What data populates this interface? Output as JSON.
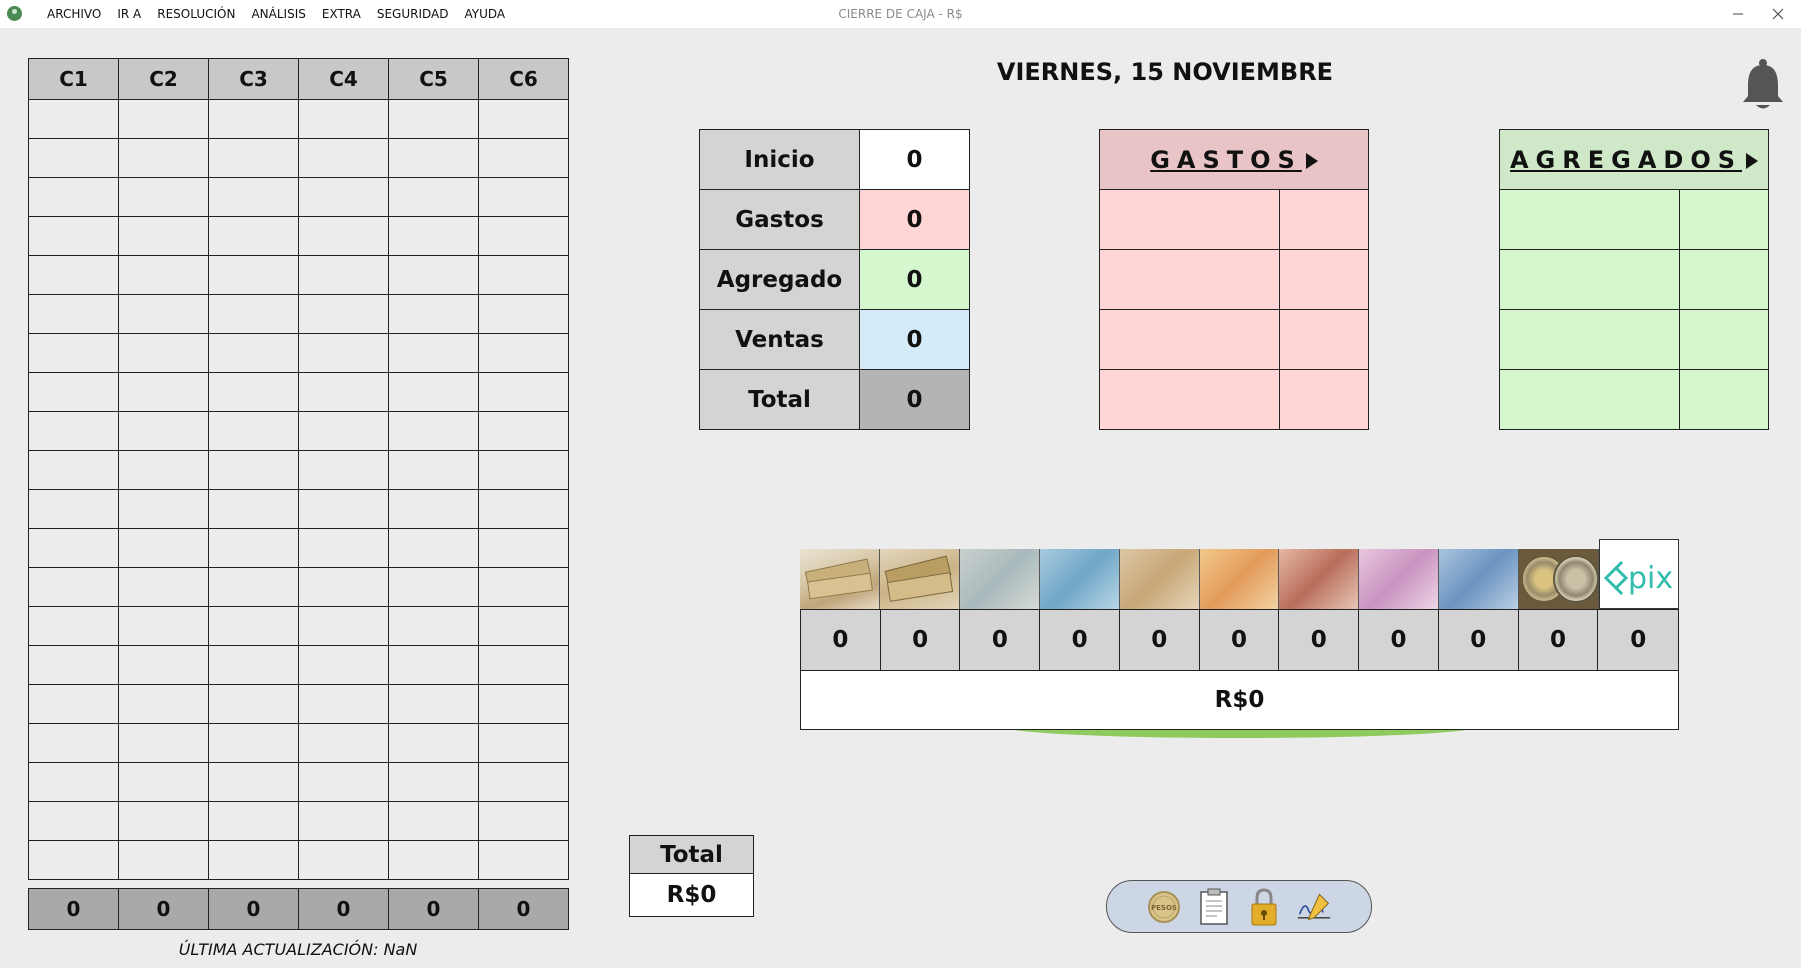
{
  "window": {
    "title": "CIERRE DE CAJA - R$",
    "menu": [
      "ARCHIVO",
      "IR A",
      "RESOLUCIÓN",
      "ANÁLISIS",
      "EXTRA",
      "SEGURIDAD",
      "AYUDA"
    ]
  },
  "grid": {
    "headers": [
      "C1",
      "C2",
      "C3",
      "C4",
      "C5",
      "C6"
    ],
    "row_count": 20,
    "sums": [
      "0",
      "0",
      "0",
      "0",
      "0",
      "0"
    ],
    "last_update_label": "ÚLTIMA ACTUALIZACIÓN: NaN"
  },
  "date": "VIERNES, 15 NOVIEMBRE",
  "summary": {
    "rows": [
      {
        "label": "Inicio",
        "value": "0",
        "color": "#ffffff"
      },
      {
        "label": "Gastos",
        "value": "0",
        "color": "#ffd5d6"
      },
      {
        "label": "Agregado",
        "value": "0",
        "color": "#d5f7cd"
      },
      {
        "label": "Ventas",
        "value": "0",
        "color": "#d3ebf9"
      },
      {
        "label": "Total",
        "value": "0",
        "color": "#b4b4b4"
      }
    ]
  },
  "gastos": {
    "title": "GASTOS",
    "color": "#ffd5d6"
  },
  "agregados": {
    "title": "AGREGADOS",
    "color": "#d5f7cd"
  },
  "money": {
    "counts": [
      "0",
      "0",
      "0",
      "0",
      "0",
      "0",
      "0",
      "0",
      "0",
      "0",
      "0"
    ],
    "total": "R$0",
    "denominations": [
      "bundle-a",
      "bundle-b",
      "200",
      "100",
      "50",
      "20",
      "10",
      "5",
      "2",
      "coin",
      "pix"
    ]
  },
  "total_box": {
    "label": "Total",
    "value": "R$0"
  },
  "toolbar": {
    "icons": [
      "pesos-coin-icon",
      "clipboard-icon",
      "lock-icon",
      "signature-icon"
    ],
    "coin_text": "PESOS"
  }
}
